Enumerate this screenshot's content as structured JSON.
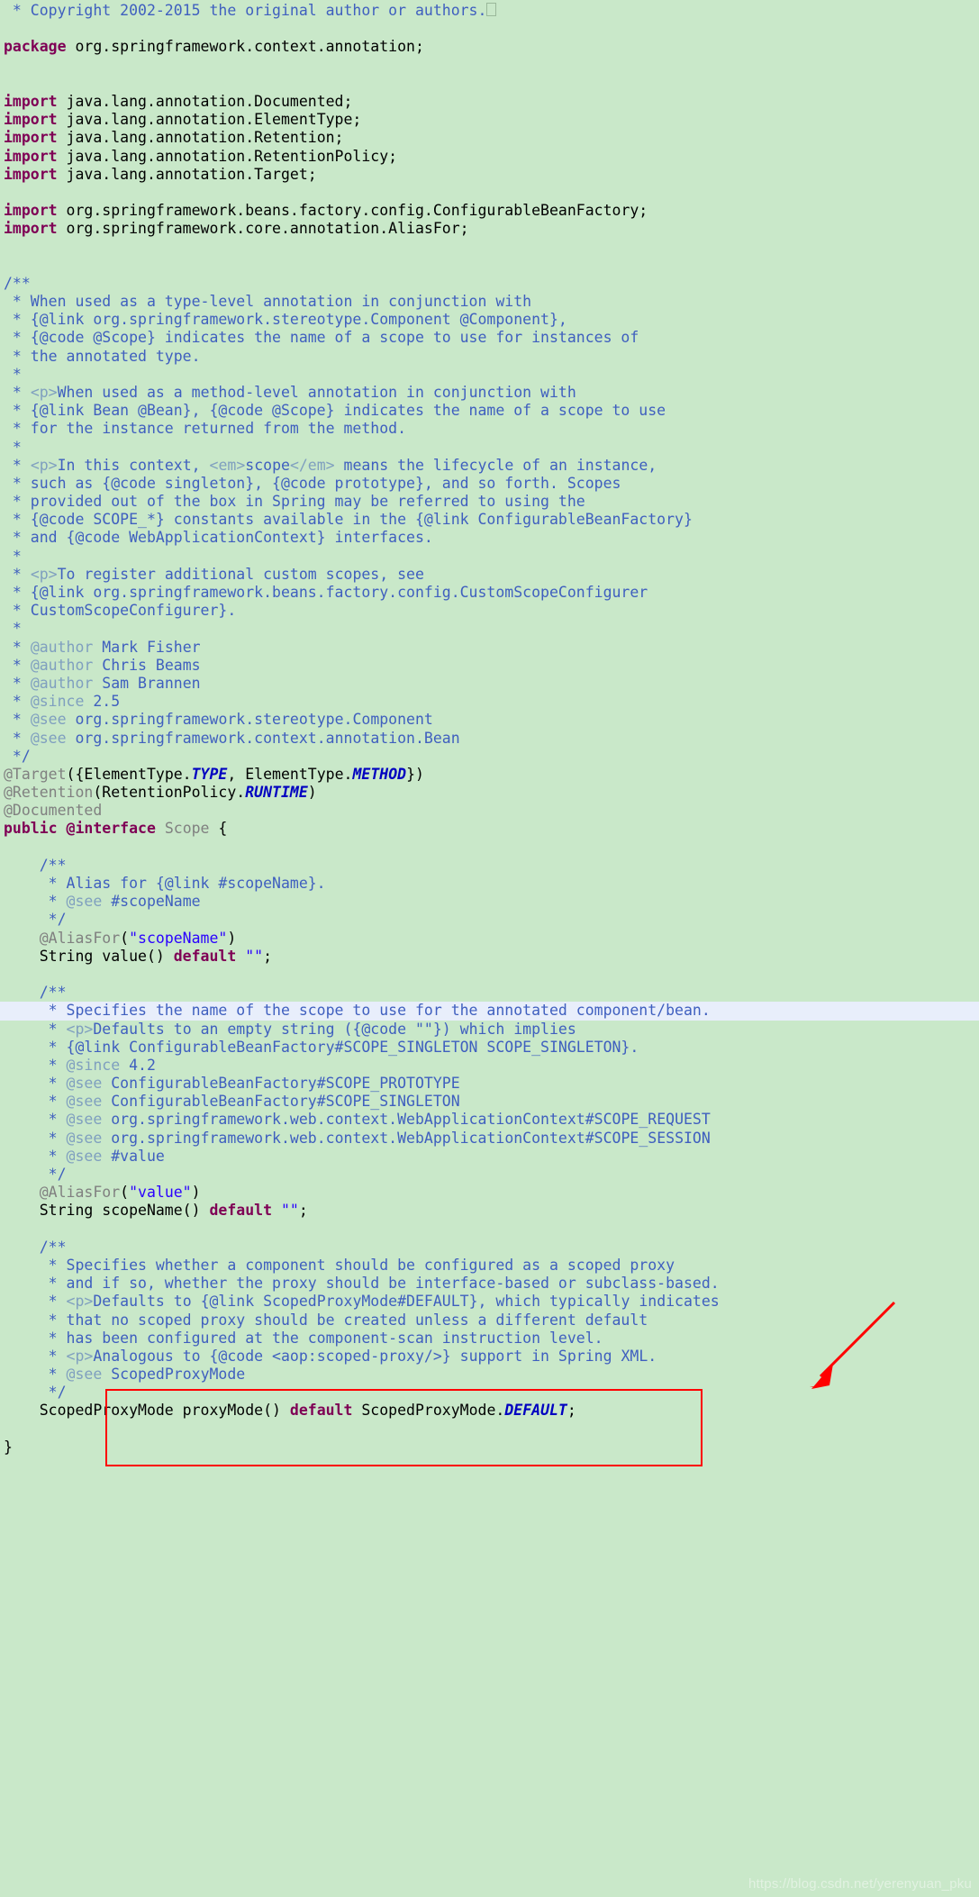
{
  "editor": {
    "language": "java",
    "background_color": "#c9e8c9",
    "highlight_line_color": "#e8eefb",
    "annotation_color": "#ff0000",
    "colors": {
      "keyword": "#7f0055",
      "comment": "#3f5fbf",
      "comment_tag": "#7f9fbf",
      "annotation": "#808080",
      "string": "#2a00ff",
      "constant": "#0000c0",
      "plain": "#000000"
    }
  },
  "annotations": {
    "red_box_label": "highlighted-see-tags",
    "red_arrow_label": "pointer-to-highlighted-see-tags"
  },
  "watermark": "https://blog.csdn.net/yerenyuan_pku",
  "lines": [
    {
      "id": 1,
      "highlight": false,
      "tokens": [
        {
          "t": "cm",
          "v": " * Copyright 2002-2015 the original author or authors."
        },
        {
          "t": "eof",
          "v": ""
        }
      ]
    },
    {
      "id": 2,
      "highlight": false,
      "tokens": []
    },
    {
      "id": 3,
      "highlight": false,
      "tokens": [
        {
          "t": "kw",
          "v": "package"
        },
        {
          "t": "pl",
          "v": " org.springframework.context.annotation;"
        }
      ]
    },
    {
      "id": 4,
      "highlight": false,
      "tokens": []
    },
    {
      "id": 5,
      "highlight": false,
      "tokens": []
    },
    {
      "id": 6,
      "highlight": false,
      "tokens": [
        {
          "t": "kw",
          "v": "import"
        },
        {
          "t": "pl",
          "v": " java.lang.annotation.Documented;"
        }
      ]
    },
    {
      "id": 7,
      "highlight": false,
      "tokens": [
        {
          "t": "kw",
          "v": "import"
        },
        {
          "t": "pl",
          "v": " java.lang.annotation.ElementType;"
        }
      ]
    },
    {
      "id": 8,
      "highlight": false,
      "tokens": [
        {
          "t": "kw",
          "v": "import"
        },
        {
          "t": "pl",
          "v": " java.lang.annotation.Retention;"
        }
      ]
    },
    {
      "id": 9,
      "highlight": false,
      "tokens": [
        {
          "t": "kw",
          "v": "import"
        },
        {
          "t": "pl",
          "v": " java.lang.annotation.RetentionPolicy;"
        }
      ]
    },
    {
      "id": 10,
      "highlight": false,
      "tokens": [
        {
          "t": "kw",
          "v": "import"
        },
        {
          "t": "pl",
          "v": " java.lang.annotation.Target;"
        }
      ]
    },
    {
      "id": 11,
      "highlight": false,
      "tokens": []
    },
    {
      "id": 12,
      "highlight": false,
      "tokens": [
        {
          "t": "kw",
          "v": "import"
        },
        {
          "t": "pl",
          "v": " org.springframework.beans.factory.config.ConfigurableBeanFactory;"
        }
      ]
    },
    {
      "id": 13,
      "highlight": false,
      "tokens": [
        {
          "t": "kw",
          "v": "import"
        },
        {
          "t": "pl",
          "v": " org.springframework.core.annotation.AliasFor;"
        }
      ]
    },
    {
      "id": 14,
      "highlight": false,
      "tokens": []
    },
    {
      "id": 15,
      "highlight": false,
      "tokens": []
    },
    {
      "id": 16,
      "highlight": false,
      "tokens": [
        {
          "t": "cm",
          "v": "/**"
        }
      ]
    },
    {
      "id": 17,
      "highlight": false,
      "tokens": [
        {
          "t": "cm",
          "v": " * When used as a type-level annotation in conjunction with"
        }
      ]
    },
    {
      "id": 18,
      "highlight": false,
      "tokens": [
        {
          "t": "cm",
          "v": " * {@link org.springframework.stereotype.Component @Component},"
        }
      ]
    },
    {
      "id": 19,
      "highlight": false,
      "tokens": [
        {
          "t": "cm",
          "v": " * {@code @Scope} indicates the name of a scope to use for instances of"
        }
      ]
    },
    {
      "id": 20,
      "highlight": false,
      "tokens": [
        {
          "t": "cm",
          "v": " * the annotated type."
        }
      ]
    },
    {
      "id": 21,
      "highlight": false,
      "tokens": [
        {
          "t": "cm",
          "v": " *"
        }
      ]
    },
    {
      "id": 22,
      "highlight": false,
      "tokens": [
        {
          "t": "cm",
          "v": " * "
        },
        {
          "t": "cmhtml",
          "v": "<p>"
        },
        {
          "t": "cm",
          "v": "When used as a method-level annotation in conjunction with"
        }
      ]
    },
    {
      "id": 23,
      "highlight": false,
      "tokens": [
        {
          "t": "cm",
          "v": " * {@link Bean @Bean}, {@code @Scope} indicates the name of a scope to use"
        }
      ]
    },
    {
      "id": 24,
      "highlight": false,
      "tokens": [
        {
          "t": "cm",
          "v": " * for the instance returned from the method."
        }
      ]
    },
    {
      "id": 25,
      "highlight": false,
      "tokens": [
        {
          "t": "cm",
          "v": " *"
        }
      ]
    },
    {
      "id": 26,
      "highlight": false,
      "tokens": [
        {
          "t": "cm",
          "v": " * "
        },
        {
          "t": "cmhtml",
          "v": "<p>"
        },
        {
          "t": "cm",
          "v": "In this context, "
        },
        {
          "t": "cmhtml",
          "v": "<em>"
        },
        {
          "t": "cm",
          "v": "scope"
        },
        {
          "t": "cmhtml",
          "v": "</em>"
        },
        {
          "t": "cm",
          "v": " means the lifecycle of an instance,"
        }
      ]
    },
    {
      "id": 27,
      "highlight": false,
      "tokens": [
        {
          "t": "cm",
          "v": " * such as {@code singleton}, {@code prototype}, and so forth. Scopes"
        }
      ]
    },
    {
      "id": 28,
      "highlight": false,
      "tokens": [
        {
          "t": "cm",
          "v": " * provided out of the box in Spring may be referred to using the"
        }
      ]
    },
    {
      "id": 29,
      "highlight": false,
      "tokens": [
        {
          "t": "cm",
          "v": " * {@code SCOPE_*} constants available in the {@link ConfigurableBeanFactory}"
        }
      ]
    },
    {
      "id": 30,
      "highlight": false,
      "tokens": [
        {
          "t": "cm",
          "v": " * and {@code WebApplicationContext} interfaces."
        }
      ]
    },
    {
      "id": 31,
      "highlight": false,
      "tokens": [
        {
          "t": "cm",
          "v": " *"
        }
      ]
    },
    {
      "id": 32,
      "highlight": false,
      "tokens": [
        {
          "t": "cm",
          "v": " * "
        },
        {
          "t": "cmhtml",
          "v": "<p>"
        },
        {
          "t": "cm",
          "v": "To register additional custom scopes, see"
        }
      ]
    },
    {
      "id": 33,
      "highlight": false,
      "tokens": [
        {
          "t": "cm",
          "v": " * {@link org.springframework.beans.factory.config.CustomScopeConfigurer"
        }
      ]
    },
    {
      "id": 34,
      "highlight": false,
      "tokens": [
        {
          "t": "cm",
          "v": " * CustomScopeConfigurer}."
        }
      ]
    },
    {
      "id": 35,
      "highlight": false,
      "tokens": [
        {
          "t": "cm",
          "v": " *"
        }
      ]
    },
    {
      "id": 36,
      "highlight": false,
      "tokens": [
        {
          "t": "cm",
          "v": " * "
        },
        {
          "t": "cmtag",
          "v": "@author"
        },
        {
          "t": "cm",
          "v": " Mark Fisher"
        }
      ]
    },
    {
      "id": 37,
      "highlight": false,
      "tokens": [
        {
          "t": "cm",
          "v": " * "
        },
        {
          "t": "cmtag",
          "v": "@author"
        },
        {
          "t": "cm",
          "v": " Chris Beams"
        }
      ]
    },
    {
      "id": 38,
      "highlight": false,
      "tokens": [
        {
          "t": "cm",
          "v": " * "
        },
        {
          "t": "cmtag",
          "v": "@author"
        },
        {
          "t": "cm",
          "v": " Sam Brannen"
        }
      ]
    },
    {
      "id": 39,
      "highlight": false,
      "tokens": [
        {
          "t": "cm",
          "v": " * "
        },
        {
          "t": "cmtag",
          "v": "@since"
        },
        {
          "t": "cm",
          "v": " 2.5"
        }
      ]
    },
    {
      "id": 40,
      "highlight": false,
      "tokens": [
        {
          "t": "cm",
          "v": " * "
        },
        {
          "t": "cmtag",
          "v": "@see"
        },
        {
          "t": "cm",
          "v": " org.springframework.stereotype.Component"
        }
      ]
    },
    {
      "id": 41,
      "highlight": false,
      "tokens": [
        {
          "t": "cm",
          "v": " * "
        },
        {
          "t": "cmtag",
          "v": "@see"
        },
        {
          "t": "cm",
          "v": " org.springframework.context.annotation.Bean"
        }
      ]
    },
    {
      "id": 42,
      "highlight": false,
      "tokens": [
        {
          "t": "cm",
          "v": " */"
        }
      ]
    },
    {
      "id": 43,
      "highlight": false,
      "tokens": [
        {
          "t": "ann",
          "v": "@Target"
        },
        {
          "t": "pl",
          "v": "({ElementType."
        },
        {
          "t": "cst",
          "v": "TYPE"
        },
        {
          "t": "pl",
          "v": ", ElementType."
        },
        {
          "t": "cst",
          "v": "METHOD"
        },
        {
          "t": "pl",
          "v": "})"
        }
      ]
    },
    {
      "id": 44,
      "highlight": false,
      "tokens": [
        {
          "t": "ann",
          "v": "@Retention"
        },
        {
          "t": "pl",
          "v": "(RetentionPolicy."
        },
        {
          "t": "cst",
          "v": "RUNTIME"
        },
        {
          "t": "pl",
          "v": ")"
        }
      ]
    },
    {
      "id": 45,
      "highlight": false,
      "tokens": [
        {
          "t": "ann",
          "v": "@Documented"
        }
      ]
    },
    {
      "id": 46,
      "highlight": false,
      "tokens": [
        {
          "t": "kw",
          "v": "public"
        },
        {
          "t": "pl",
          "v": " "
        },
        {
          "t": "kw",
          "v": "@interface"
        },
        {
          "t": "ann",
          "v": " Scope"
        },
        {
          "t": "pl",
          "v": " {"
        }
      ]
    },
    {
      "id": 47,
      "highlight": false,
      "tokens": []
    },
    {
      "id": 48,
      "highlight": false,
      "tokens": [
        {
          "t": "cm",
          "v": "    /**"
        }
      ]
    },
    {
      "id": 49,
      "highlight": false,
      "tokens": [
        {
          "t": "cm",
          "v": "     * Alias for {@link #scopeName}."
        }
      ]
    },
    {
      "id": 50,
      "highlight": false,
      "tokens": [
        {
          "t": "cm",
          "v": "     * "
        },
        {
          "t": "cmtag",
          "v": "@see"
        },
        {
          "t": "cm",
          "v": " #scopeName"
        }
      ]
    },
    {
      "id": 51,
      "highlight": false,
      "tokens": [
        {
          "t": "cm",
          "v": "     */"
        }
      ]
    },
    {
      "id": 52,
      "highlight": false,
      "tokens": [
        {
          "t": "ann",
          "v": "    @AliasFor"
        },
        {
          "t": "pl",
          "v": "("
        },
        {
          "t": "str",
          "v": "\"scopeName\""
        },
        {
          "t": "pl",
          "v": ")"
        }
      ]
    },
    {
      "id": 53,
      "highlight": false,
      "tokens": [
        {
          "t": "pl",
          "v": "    String value() "
        },
        {
          "t": "kw",
          "v": "default"
        },
        {
          "t": "pl",
          "v": " "
        },
        {
          "t": "str",
          "v": "\"\""
        },
        {
          "t": "pl",
          "v": ";"
        }
      ]
    },
    {
      "id": 54,
      "highlight": false,
      "tokens": []
    },
    {
      "id": 55,
      "highlight": false,
      "tokens": [
        {
          "t": "cm",
          "v": "    /**"
        }
      ]
    },
    {
      "id": 56,
      "highlight": true,
      "tokens": [
        {
          "t": "cm",
          "v": "     * Specifies the name of the scope to use for the annotated component/bean."
        }
      ]
    },
    {
      "id": 57,
      "highlight": false,
      "tokens": [
        {
          "t": "cm",
          "v": "     * "
        },
        {
          "t": "cmhtml",
          "v": "<p>"
        },
        {
          "t": "cm",
          "v": "Defaults to an empty string ({@code \"\"}) which implies"
        }
      ]
    },
    {
      "id": 58,
      "highlight": false,
      "tokens": [
        {
          "t": "cm",
          "v": "     * {@link ConfigurableBeanFactory#SCOPE_SINGLETON SCOPE_SINGLETON}."
        }
      ]
    },
    {
      "id": 59,
      "highlight": false,
      "tokens": [
        {
          "t": "cm",
          "v": "     * "
        },
        {
          "t": "cmtag",
          "v": "@since"
        },
        {
          "t": "cm",
          "v": " 4.2"
        }
      ]
    },
    {
      "id": 60,
      "highlight": false,
      "tokens": [
        {
          "t": "cm",
          "v": "     * "
        },
        {
          "t": "cmtag",
          "v": "@see"
        },
        {
          "t": "cm",
          "v": " ConfigurableBeanFactory#SCOPE_PROTOTYPE"
        }
      ]
    },
    {
      "id": 61,
      "highlight": false,
      "tokens": [
        {
          "t": "cm",
          "v": "     * "
        },
        {
          "t": "cmtag",
          "v": "@see"
        },
        {
          "t": "cm",
          "v": " ConfigurableBeanFactory#SCOPE_SINGLETON"
        }
      ]
    },
    {
      "id": 62,
      "highlight": false,
      "tokens": [
        {
          "t": "cm",
          "v": "     * "
        },
        {
          "t": "cmtag",
          "v": "@see"
        },
        {
          "t": "cm",
          "v": " org.springframework.web.context.WebApplicationContext#SCOPE_REQUEST"
        }
      ]
    },
    {
      "id": 63,
      "highlight": false,
      "tokens": [
        {
          "t": "cm",
          "v": "     * "
        },
        {
          "t": "cmtag",
          "v": "@see"
        },
        {
          "t": "cm",
          "v": " org.springframework.web.context.WebApplicationContext#SCOPE_SESSION"
        }
      ]
    },
    {
      "id": 64,
      "highlight": false,
      "tokens": [
        {
          "t": "cm",
          "v": "     * "
        },
        {
          "t": "cmtag",
          "v": "@see"
        },
        {
          "t": "cm",
          "v": " #value"
        }
      ]
    },
    {
      "id": 65,
      "highlight": false,
      "tokens": [
        {
          "t": "cm",
          "v": "     */"
        }
      ]
    },
    {
      "id": 66,
      "highlight": false,
      "tokens": [
        {
          "t": "ann",
          "v": "    @AliasFor"
        },
        {
          "t": "pl",
          "v": "("
        },
        {
          "t": "str",
          "v": "\"value\""
        },
        {
          "t": "pl",
          "v": ")"
        }
      ]
    },
    {
      "id": 67,
      "highlight": false,
      "tokens": [
        {
          "t": "pl",
          "v": "    String scopeName() "
        },
        {
          "t": "kw",
          "v": "default"
        },
        {
          "t": "pl",
          "v": " "
        },
        {
          "t": "str",
          "v": "\"\""
        },
        {
          "t": "pl",
          "v": ";"
        }
      ]
    },
    {
      "id": 68,
      "highlight": false,
      "tokens": []
    },
    {
      "id": 69,
      "highlight": false,
      "tokens": [
        {
          "t": "cm",
          "v": "    /**"
        }
      ]
    },
    {
      "id": 70,
      "highlight": false,
      "tokens": [
        {
          "t": "cm",
          "v": "     * Specifies whether a component should be configured as a scoped proxy"
        }
      ]
    },
    {
      "id": 71,
      "highlight": false,
      "tokens": [
        {
          "t": "cm",
          "v": "     * and if so, whether the proxy should be interface-based or subclass-based."
        }
      ]
    },
    {
      "id": 72,
      "highlight": false,
      "tokens": [
        {
          "t": "cm",
          "v": "     * "
        },
        {
          "t": "cmhtml",
          "v": "<p>"
        },
        {
          "t": "cm",
          "v": "Defaults to {@link ScopedProxyMode#DEFAULT}, which typically indicates"
        }
      ]
    },
    {
      "id": 73,
      "highlight": false,
      "tokens": [
        {
          "t": "cm",
          "v": "     * that no scoped proxy should be created unless a different default"
        }
      ]
    },
    {
      "id": 74,
      "highlight": false,
      "tokens": [
        {
          "t": "cm",
          "v": "     * has been configured at the component-scan instruction level."
        }
      ]
    },
    {
      "id": 75,
      "highlight": false,
      "tokens": [
        {
          "t": "cm",
          "v": "     * "
        },
        {
          "t": "cmhtml",
          "v": "<p>"
        },
        {
          "t": "cm",
          "v": "Analogous to {@code <aop:scoped-proxy/>} support in Spring XML."
        }
      ]
    },
    {
      "id": 76,
      "highlight": false,
      "tokens": [
        {
          "t": "cm",
          "v": "     * "
        },
        {
          "t": "cmtag",
          "v": "@see"
        },
        {
          "t": "cm",
          "v": " ScopedProxyMode"
        }
      ]
    },
    {
      "id": 77,
      "highlight": false,
      "tokens": [
        {
          "t": "cm",
          "v": "     */"
        }
      ]
    },
    {
      "id": 78,
      "highlight": false,
      "tokens": [
        {
          "t": "pl",
          "v": "    ScopedProxyMode proxyMode() "
        },
        {
          "t": "kw",
          "v": "default"
        },
        {
          "t": "pl",
          "v": " ScopedProxyMode."
        },
        {
          "t": "cst",
          "v": "DEFAULT"
        },
        {
          "t": "pl",
          "v": ";"
        }
      ]
    },
    {
      "id": 79,
      "highlight": false,
      "tokens": []
    },
    {
      "id": 80,
      "highlight": false,
      "tokens": [
        {
          "t": "pl",
          "v": "}"
        }
      ]
    }
  ]
}
